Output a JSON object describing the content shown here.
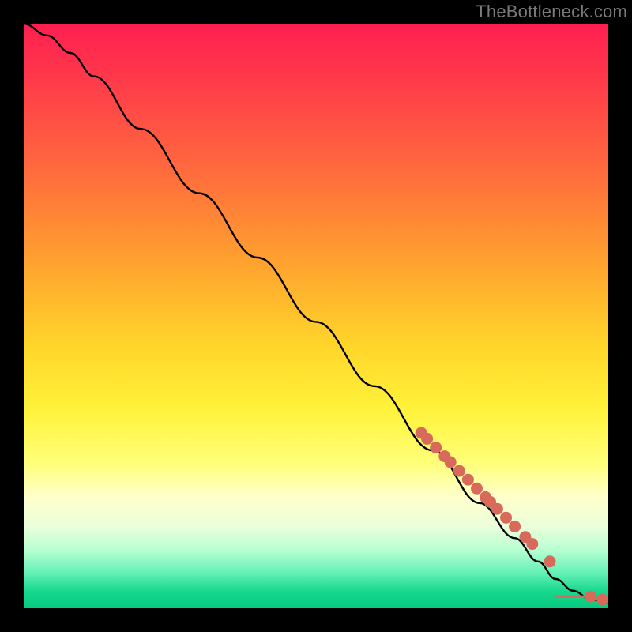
{
  "watermark": "TheBottleneck.com",
  "chart_data": {
    "type": "line",
    "title": "",
    "xlabel": "",
    "ylabel": "",
    "xlim": [
      0,
      100
    ],
    "ylim": [
      0,
      100
    ],
    "series": [
      {
        "name": "curve",
        "x": [
          0,
          4,
          8,
          12,
          20,
          30,
          40,
          50,
          60,
          70,
          78,
          84,
          88,
          91,
          94,
          97,
          100
        ],
        "y": [
          100,
          98,
          95,
          91,
          82,
          71,
          60,
          49,
          38,
          27,
          18,
          12,
          8,
          5,
          3,
          1.5,
          1
        ]
      }
    ],
    "markers": {
      "name": "highlighted-points",
      "color": "#d86a5c",
      "x": [
        68,
        69,
        70.5,
        72,
        73,
        74.5,
        76,
        77.5,
        79,
        79.8,
        81,
        82.5,
        84,
        85.8,
        87,
        90,
        97,
        99
      ],
      "y": [
        30,
        29,
        27.5,
        26,
        25,
        23.5,
        22,
        20.5,
        19,
        18.2,
        17,
        15.5,
        14,
        12.2,
        11,
        8,
        2,
        1.5
      ]
    },
    "tail_segment": {
      "x": [
        91,
        97
      ],
      "y": [
        2,
        2
      ]
    }
  }
}
